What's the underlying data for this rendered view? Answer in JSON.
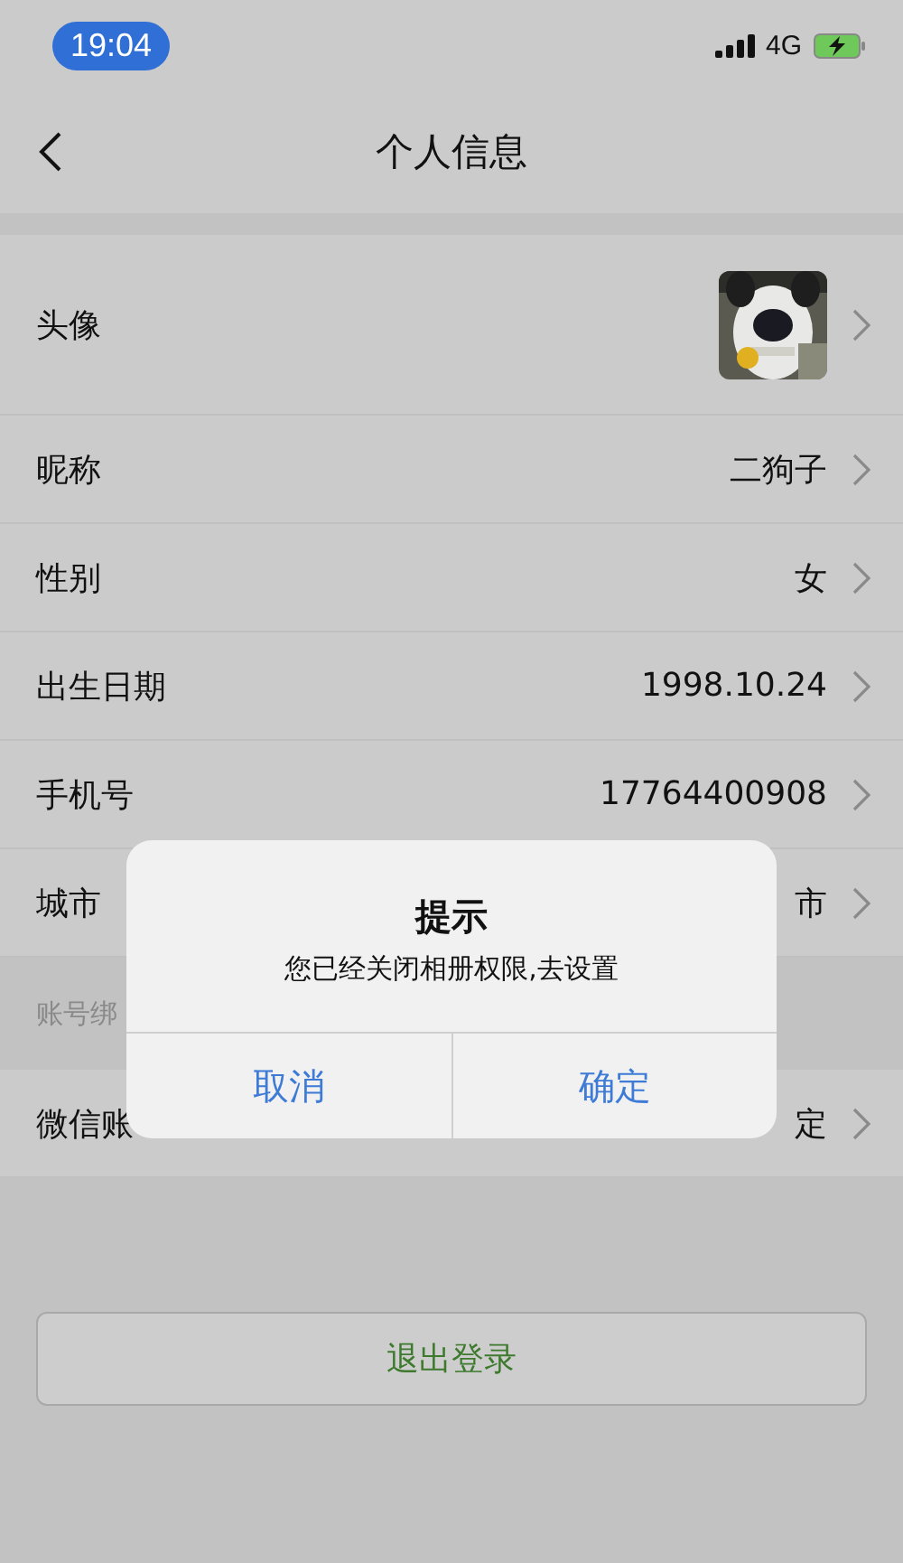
{
  "status_bar": {
    "time": "19:04",
    "network": "4G"
  },
  "nav": {
    "title": "个人信息"
  },
  "rows": [
    {
      "kind": "avatar",
      "label": "头像"
    },
    {
      "kind": "text",
      "label": "昵称",
      "value": "二狗子"
    },
    {
      "kind": "text",
      "label": "性别",
      "value": "女"
    },
    {
      "kind": "text",
      "label": "出生日期",
      "value": "1998.10.24"
    },
    {
      "kind": "text",
      "label": "手机号",
      "value": "17764400908"
    },
    {
      "kind": "text",
      "label": "城市",
      "value": "市"
    }
  ],
  "section": {
    "title": "账号绑"
  },
  "binding_rows": [
    {
      "kind": "text",
      "label": "微信账",
      "value": "定"
    }
  ],
  "logout_button": "退出登录",
  "dialog": {
    "title": "提示",
    "message": "您已经关闭相册权限,去设置",
    "buttons": [
      "取消",
      "确定"
    ]
  }
}
